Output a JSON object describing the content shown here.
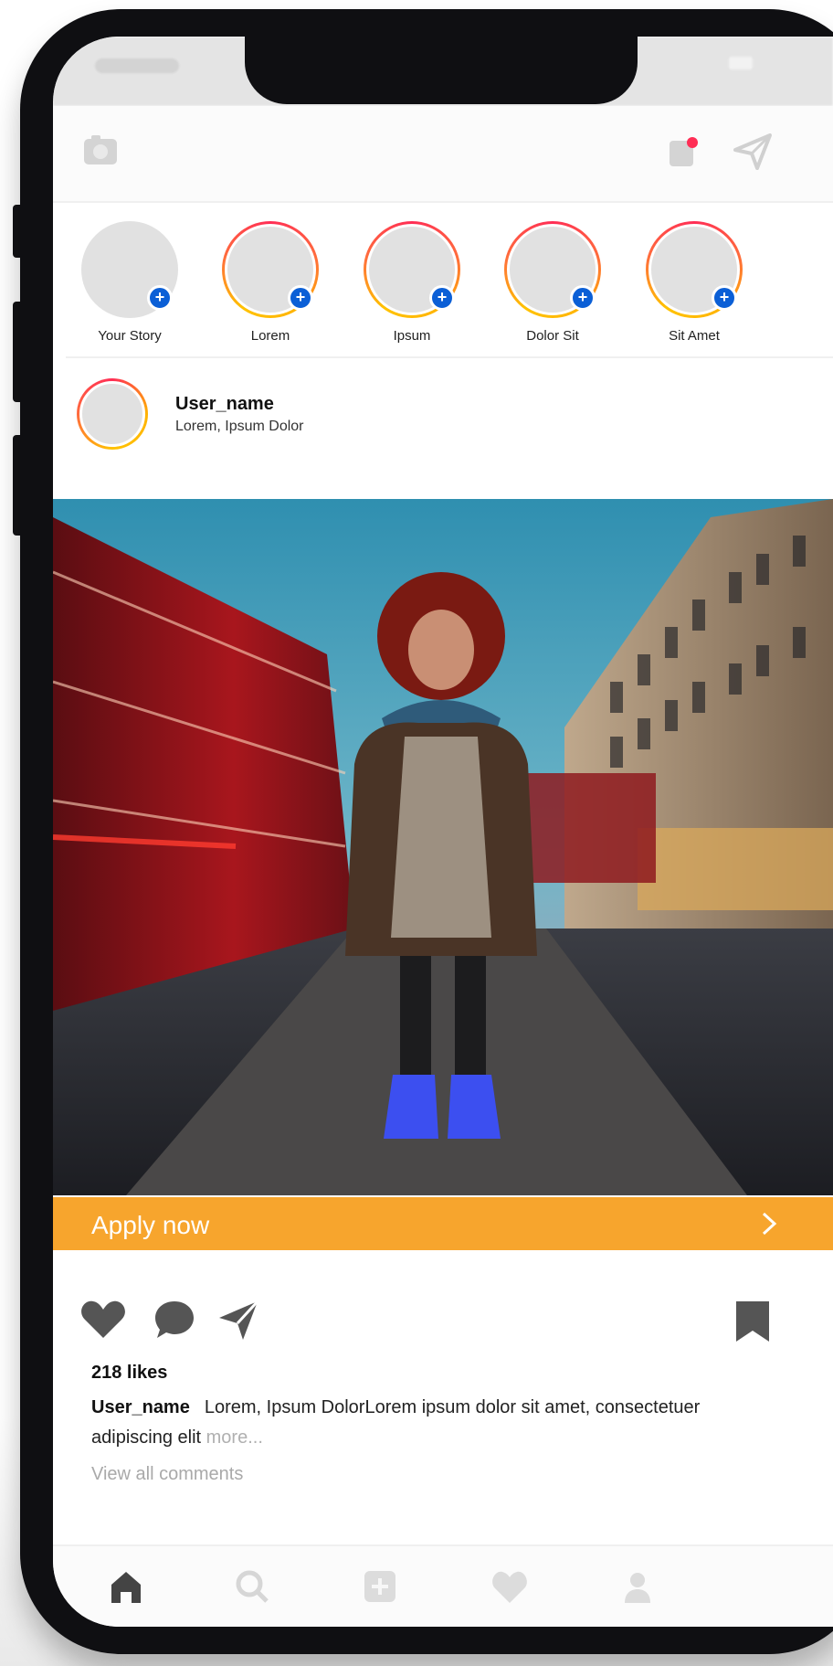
{
  "status_bar": {},
  "header": {
    "camera_icon": "camera-icon",
    "activity_icon": "activity-icon",
    "direct_icon": "paper-plane-icon",
    "notification_color": "#ff2d55"
  },
  "stories": [
    {
      "label": "Your Story",
      "own": true
    },
    {
      "label": "Lorem",
      "own": false
    },
    {
      "label": "Ipsum",
      "own": false
    },
    {
      "label": "Dolor Sit",
      "own": false
    },
    {
      "label": "Sit Amet",
      "own": false
    }
  ],
  "story_plus_symbol": "+",
  "post": {
    "username": "User_name",
    "location": "Lorem, Ipsum Dolor",
    "cta_label": "Apply now",
    "cta_color": "#f7a52d",
    "likes": "218 likes",
    "caption_user": "User_name",
    "caption_text": "Lorem, Ipsum DolorLorem ipsum dolor sit amet, consectetuer adipiscing elit",
    "caption_more": "more...",
    "view_comments": "View all comments"
  },
  "tabs": [
    "home-icon",
    "search-icon",
    "add-post-icon",
    "activity-icon",
    "profile-icon"
  ]
}
